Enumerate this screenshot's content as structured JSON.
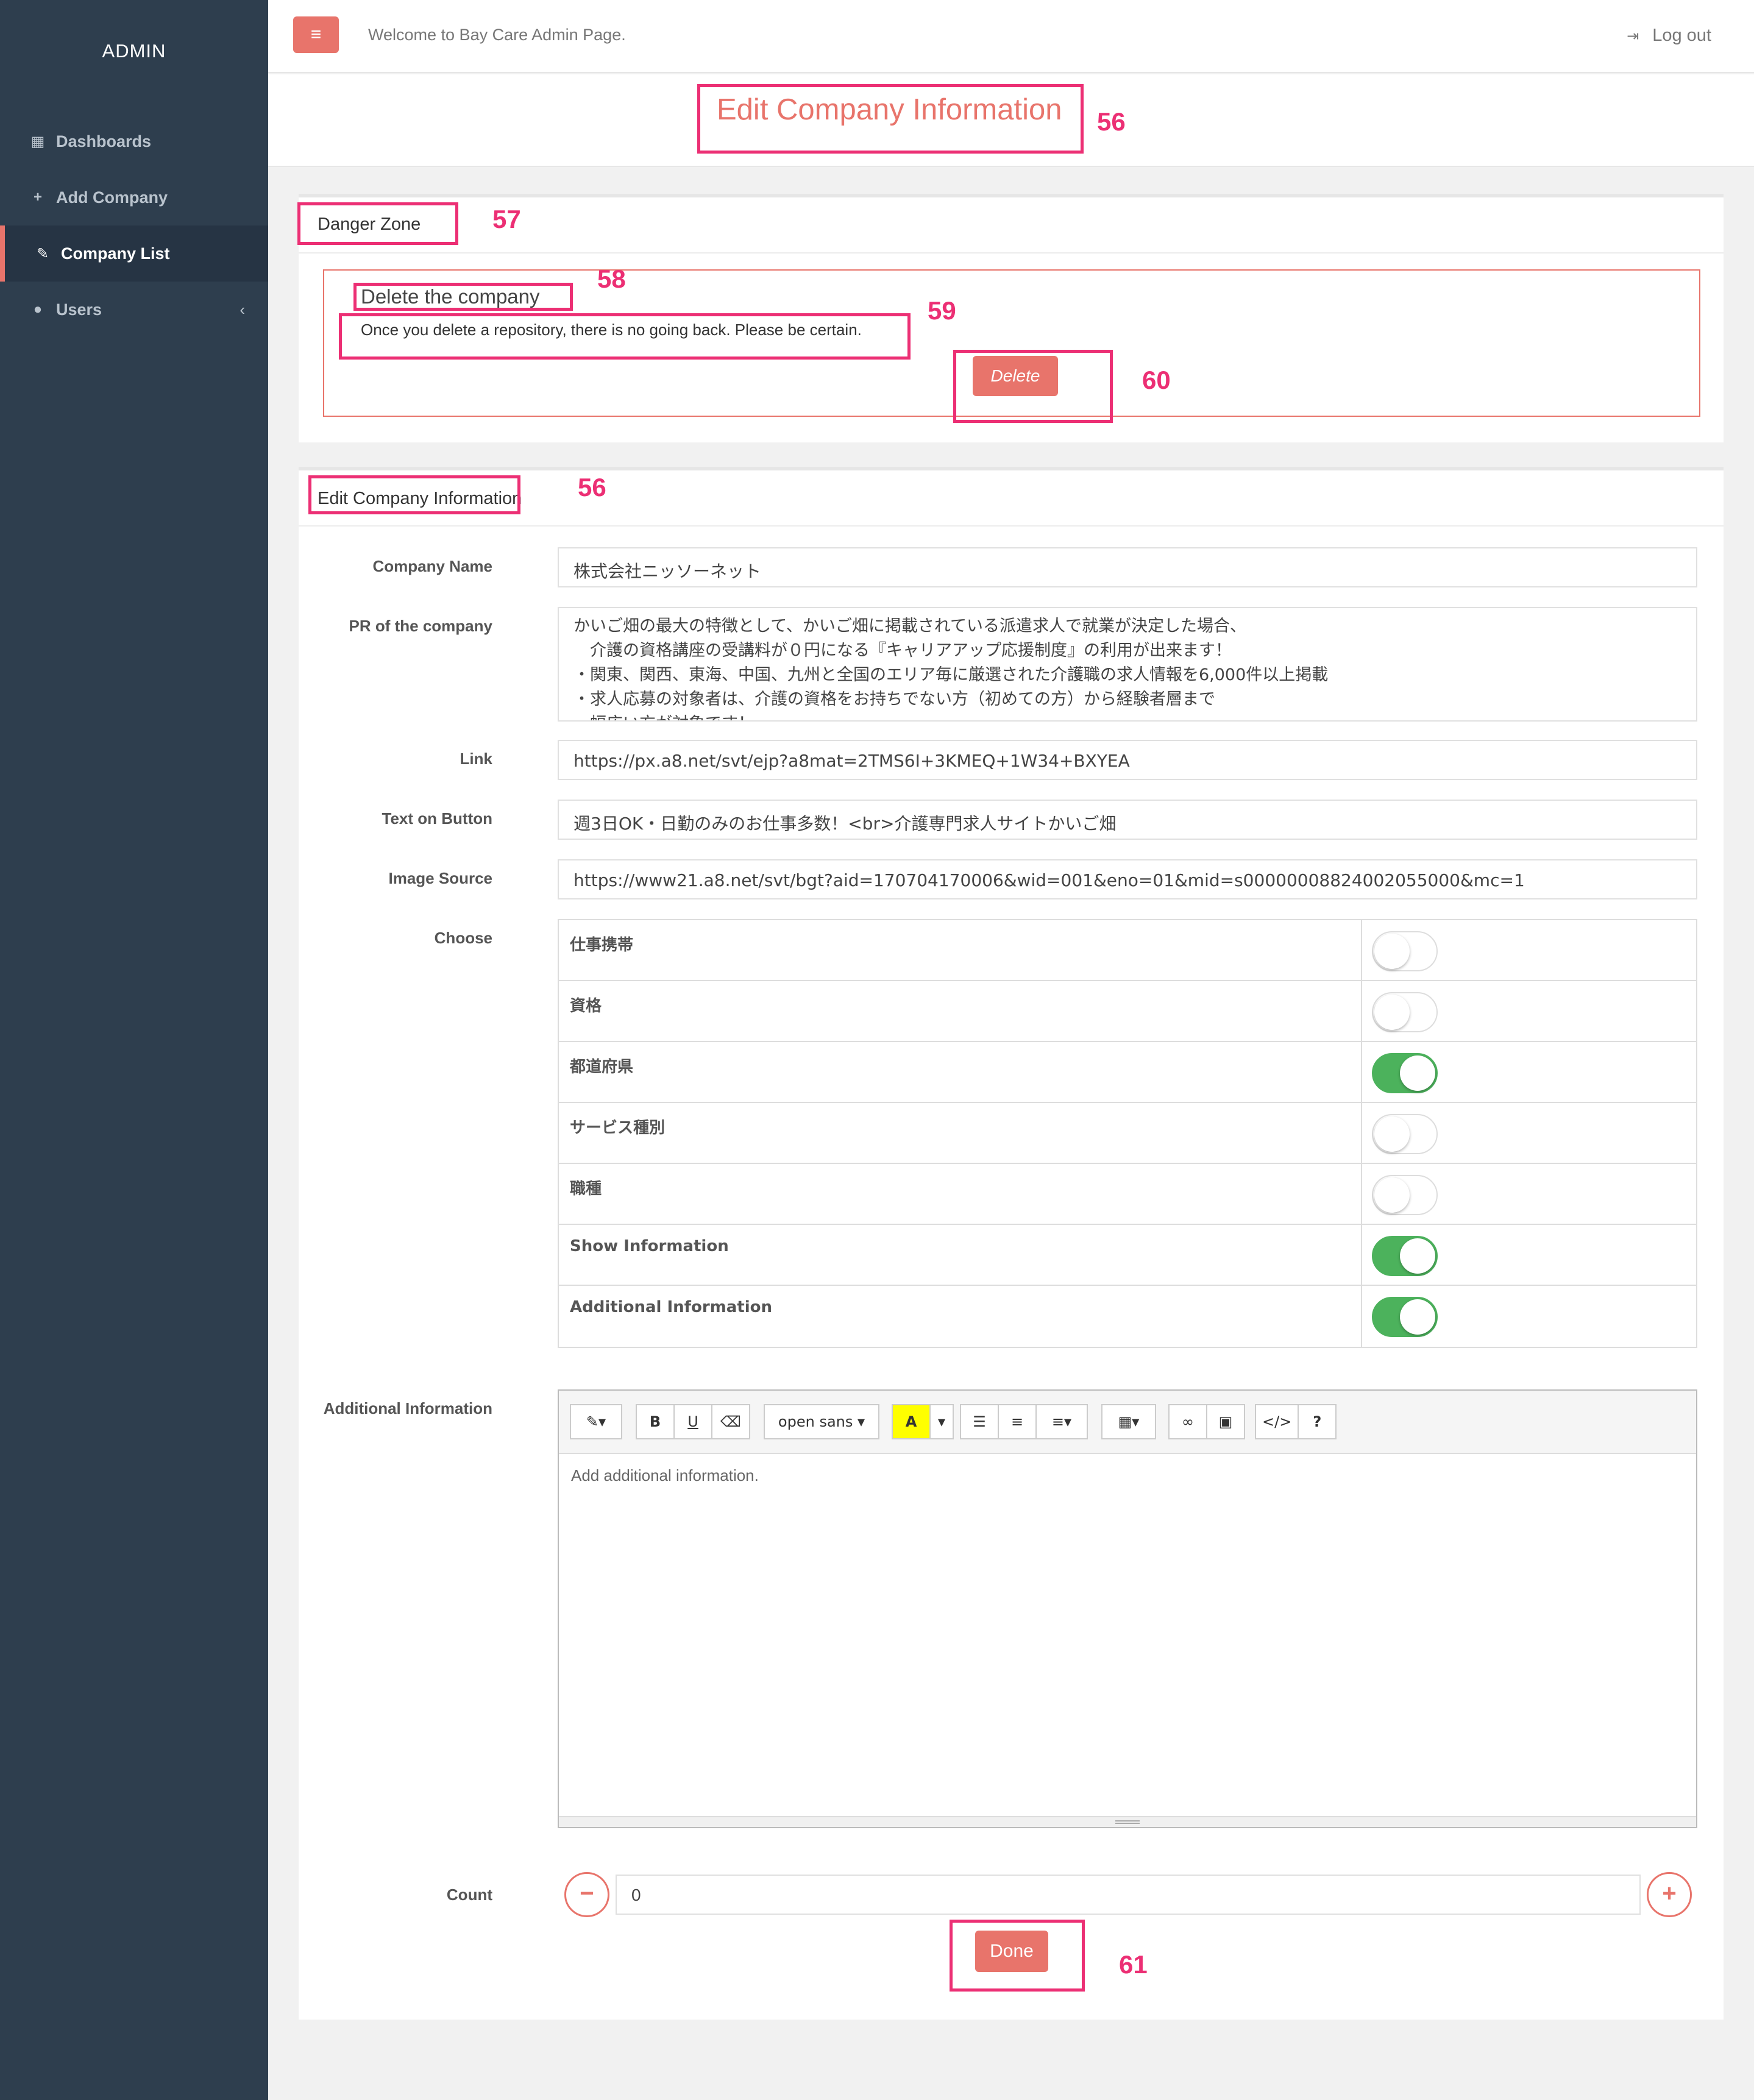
{
  "sidebar": {
    "brand": "ADMIN",
    "items": [
      {
        "label": "Dashboards",
        "icon": "dashboard-icon"
      },
      {
        "label": "Add Company",
        "icon": "plus-icon"
      },
      {
        "label": "Company List",
        "icon": "edit-icon",
        "active": true
      },
      {
        "label": "Users",
        "icon": "user-icon"
      }
    ]
  },
  "topbar": {
    "menu_icon": "≡",
    "welcome": "Welcome to Bay Care Admin Page.",
    "logout": "Log out"
  },
  "page": {
    "title": "Edit Company Information"
  },
  "danger": {
    "title": "Danger Zone",
    "delete_title": "Delete the company",
    "description": "Once you delete a repository, there is no going back. Please be certain.",
    "delete_button": "Delete"
  },
  "edit": {
    "title": "Edit Company Information",
    "company_name_label": "Company Name",
    "company_name": "株式会社ニッソーネット",
    "pr_label": "PR of the company",
    "pr_text": "かいご畑の最大の特徴として、かいご畑に掲載されている派遣求人で就業が決定した場合、\n　介護の資格講座の受講料が０円になる『キャリアアップ応援制度』の利用が出来ます！\n・関東、関西、東海、中国、九州と全国のエリア毎に厳選された介護職の求人情報を6,000件以上掲載\n・求人応募の対象者は、介護の資格をお持ちでない方（初めての方）から経験者層まで\n　幅広い方が対象です！",
    "link_label": "Link",
    "link": "https://px.a8.net/svt/ejp?a8mat=2TMS6I+3KMEQ+1W34+BXYEA",
    "button_text_label": "Text on Button",
    "button_text": "週3日OK・日勤のみのお仕事多数！<br>介護専門求人サイトかいご畑",
    "image_source_label": "Image Source",
    "image_source": "https://www21.a8.net/svt/bgt?aid=170704170006&wid=001&eno=01&mid=s00000008824002055000&mc=1",
    "choose_label": "Choose",
    "choices": [
      {
        "label": "仕事携帯",
        "on": false
      },
      {
        "label": "資格",
        "on": false
      },
      {
        "label": "都道府県",
        "on": true
      },
      {
        "label": "サービス種別",
        "on": false
      },
      {
        "label": "職種",
        "on": false
      },
      {
        "label": "Show Information",
        "on": true
      },
      {
        "label": "Additional Information",
        "on": true
      }
    ],
    "additional_label": "Additional Information",
    "editor_placeholder": "Add additional information.",
    "font_select": "open sans",
    "count_label": "Count",
    "count_value": "0",
    "done_button": "Done"
  },
  "annotations": {
    "a56_top": "56",
    "a57": "57",
    "a58": "58",
    "a59": "59",
    "a60": "60",
    "a56_panel": "56",
    "a61": "61"
  },
  "colors": {
    "accent": "#e8746b",
    "sidebar": "#2e3e4e",
    "toggle_on": "#4cb25c",
    "annotation": "#ec2f74"
  }
}
